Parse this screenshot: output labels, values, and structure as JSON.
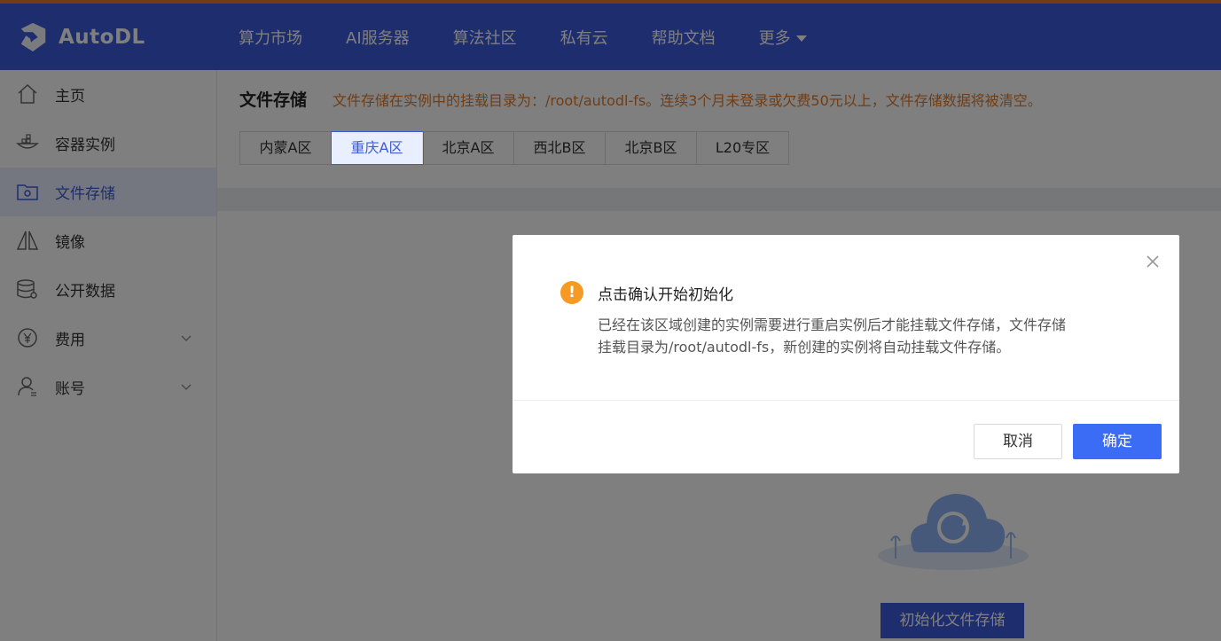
{
  "header": {
    "brand": "AutoDL",
    "nav": [
      {
        "label": "算力市场"
      },
      {
        "label": "AI服务器"
      },
      {
        "label": "算法社区"
      },
      {
        "label": "私有云"
      },
      {
        "label": "帮助文档"
      },
      {
        "label": "更多"
      }
    ]
  },
  "sidebar": {
    "items": [
      {
        "label": "主页",
        "icon": "home-icon"
      },
      {
        "label": "容器实例",
        "icon": "container-icon"
      },
      {
        "label": "文件存储",
        "icon": "folder-gear-icon",
        "active": true
      },
      {
        "label": "镜像",
        "icon": "mirror-icon"
      },
      {
        "label": "公开数据",
        "icon": "database-icon"
      },
      {
        "label": "费用",
        "icon": "yen-icon",
        "expandable": true
      },
      {
        "label": "账号",
        "icon": "user-icon",
        "expandable": true
      }
    ]
  },
  "main": {
    "title": "文件存储",
    "note": "文件存储在实例中的挂载目录为：/root/autodl-fs。连续3个月未登录或欠费50元以上，文件存储数据将被清空。",
    "tabs": [
      {
        "label": "内蒙A区"
      },
      {
        "label": "重庆A区",
        "active": true
      },
      {
        "label": "北京A区"
      },
      {
        "label": "西北B区"
      },
      {
        "label": "北京B区"
      },
      {
        "label": "L20专区"
      }
    ],
    "init_button": "初始化文件存储"
  },
  "dialog": {
    "title": "点击确认开始初始化",
    "body_line1": "已经在该区域创建的实例需要进行重启实例后才能挂载文件存储，文件存储",
    "body_line2": "挂载目录为/root/autodl-fs，新创建的实例将自动挂载文件存储。",
    "cancel": "取消",
    "confirm": "确定",
    "warn_glyph": "!"
  },
  "colors": {
    "brand_blue": "#3b5bdb",
    "accent_orange": "#e07a2a",
    "warning": "#f59a23",
    "confirm_button": "#3b6cf6"
  }
}
